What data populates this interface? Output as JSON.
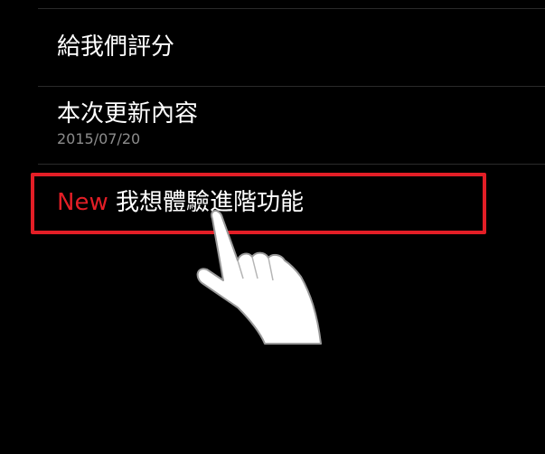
{
  "menu": {
    "items": [
      {
        "title": "給我們評分"
      },
      {
        "title": "本次更新內容",
        "subtitle": "2015/07/20"
      },
      {
        "badge": "New",
        "title": "我想體驗進階功能"
      }
    ]
  },
  "colors": {
    "background": "#000000",
    "highlight": "#e31e26",
    "subtitle": "#8c8c8c",
    "divider": "#2a2a2a"
  },
  "icons": {
    "pointer": "pointing-hand-icon"
  }
}
